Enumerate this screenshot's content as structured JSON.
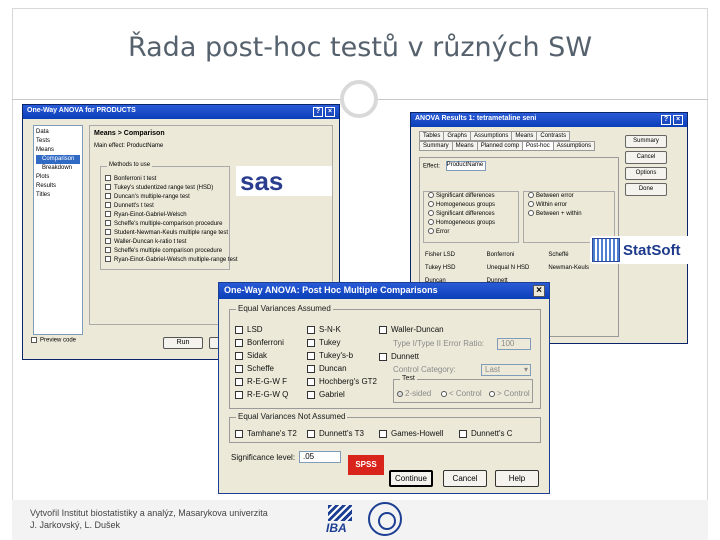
{
  "slide": {
    "title": "Řada post-hoc testů v různých SW",
    "footer_line1": "Vytvořil Institut biostatistiky a analýz, Masarykova univerzita",
    "footer_line2": "J. Jarkovský, L. Dušek",
    "iba_logo_text": "IBA"
  },
  "sas": {
    "window_title": "One-Way ANOVA for PRODUCTS",
    "tree": [
      "Data",
      "Tests",
      "Means",
      "Comparison",
      "Breakdown",
      "Plots",
      "Results",
      "Titles"
    ],
    "panel_header": "Means > Comparison",
    "main_effect": "Main effect: ProductName",
    "methods_legend": "Methods to use",
    "methods": [
      "Bonferroni t test",
      "Tukey's studentized range test (HSD)",
      "Duncan's multiple-range test",
      "Dunnett's t test",
      "Ryan-Einot-Gabriel-Welsch",
      "Scheffe's multiple-comparison procedure",
      "Student-Newman-Keuls multiple range test",
      "Waller-Duncan k-ratio t test",
      "Scheffe's multiple comparison procedure",
      "Ryan-Einot-Gabriel-Welsch multiple-range test"
    ],
    "preview_label": "Preview code",
    "run_label": "Run",
    "save_label": "Save",
    "logo_text": "sas"
  },
  "statsoft": {
    "window_title": "ANOVA Results 1: tetrametaline seni",
    "tabs_row1": [
      "Tables",
      "Graphs",
      "Assumptions",
      "Means",
      "Contrasts"
    ],
    "tabs_row2": [
      "Summary",
      "Means",
      "Planned comp",
      "Post-hoc",
      "Assumptions"
    ],
    "effect_label": "Effect:",
    "effect_value": "ProductName",
    "options": [
      "Significant differences",
      "Homogeneous groups",
      "Significant differences",
      "Homogeneous groups",
      "Error"
    ],
    "between_options": [
      "Between error",
      "Within error",
      "Between + within"
    ],
    "bottom_buttons": [
      "Fisher LSD",
      "Bonferroni",
      "Scheffé",
      "Tukey HSD",
      "Unequal N HSD",
      "Newman-Keuls",
      "Duncan",
      "Dunnett"
    ],
    "side_buttons": [
      "Summary",
      "Cancel",
      "Options",
      "Done"
    ],
    "logo_text": "StatSoft"
  },
  "spss": {
    "window_title": "One-Way ANOVA: Post Hoc Multiple Comparisons",
    "close_glyph": "×",
    "equal_legend": "Equal Variances Assumed",
    "equal_col1": [
      "LSD",
      "Bonferroni",
      "Sidak",
      "Scheffe",
      "R-E-G-W F",
      "R-E-G-W Q"
    ],
    "equal_col2": [
      "S-N-K",
      "Tukey",
      "Tukey's-b",
      "Duncan",
      "Hochberg's GT2",
      "Gabriel"
    ],
    "equal_col3": [
      "Waller-Duncan",
      "Dunnett"
    ],
    "type_ratio_label": "Type I/Type II Error Ratio:",
    "type_ratio_value": "100",
    "control_category_label": "Control Category:",
    "control_category_value": "Last",
    "test_legend": "Test",
    "test_options": [
      "2-sided",
      "< Control",
      "> Control"
    ],
    "unequal_legend": "Equal Variances Not Assumed",
    "unequal_items": [
      "Tamhane's T2",
      "Dunnett's T3",
      "Games-Howell",
      "Dunnett's C"
    ],
    "sig_label": "Significance level:",
    "sig_value": ".05",
    "buttons": [
      "Continue",
      "Cancel",
      "Help"
    ],
    "logo_text": "SPSS"
  }
}
